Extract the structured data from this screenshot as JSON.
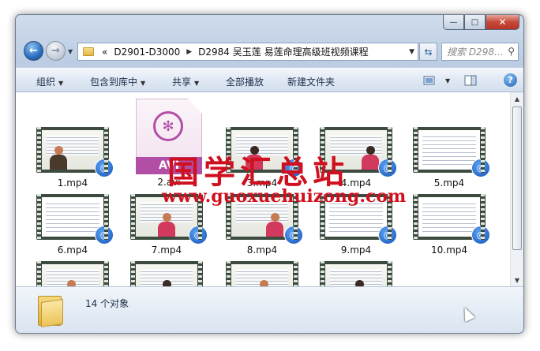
{
  "window": {
    "caption_buttons": {
      "minimize": "—",
      "maximize": "□",
      "close": "✕"
    }
  },
  "nav": {
    "back_glyph": "←",
    "forward_glyph": "→",
    "recent_glyph": "▼",
    "breadcrumb": [
      {
        "label": "«",
        "kind": "overflow"
      },
      {
        "label": "D2901-D3000"
      },
      {
        "label": "D2984 吴玉莲 易莲命理高级班视频课程"
      }
    ],
    "breadcrumb_separator": "▶",
    "address_dropdown": "▼",
    "refresh_glyph": "⇆",
    "search_placeholder": "搜索 D298...",
    "search_icon_glyph": "⚲"
  },
  "toolbar": {
    "organize": "组织",
    "include_in_library": "包含到库中",
    "share": "共享",
    "play_all": "全部播放",
    "new_folder": "新建文件夹",
    "dropdown_arrow": "▼",
    "help": "?"
  },
  "files": [
    {
      "name": "1.mp4",
      "kind": "video",
      "frame": "teacher"
    },
    {
      "name": "2.avi",
      "kind": "avi",
      "type_label": "AVI"
    },
    {
      "name": "3.mp4",
      "kind": "video",
      "frame": "teacher"
    },
    {
      "name": "4.mp4",
      "kind": "video",
      "frame": "teacher"
    },
    {
      "name": "5.mp4",
      "kind": "video",
      "frame": "doc"
    },
    {
      "name": "6.mp4",
      "kind": "video",
      "frame": "doc"
    },
    {
      "name": "7.mp4",
      "kind": "video",
      "frame": "teacher"
    },
    {
      "name": "8.mp4",
      "kind": "video",
      "frame": "teacher"
    },
    {
      "name": "9.mp4",
      "kind": "video",
      "frame": "doc"
    },
    {
      "name": "10.mp4",
      "kind": "video",
      "frame": "doc"
    },
    {
      "name": "",
      "kind": "video",
      "frame": "teacher"
    },
    {
      "name": "",
      "kind": "video",
      "frame": "teacher"
    },
    {
      "name": "",
      "kind": "video",
      "frame": "teacher"
    },
    {
      "name": "",
      "kind": "video",
      "frame": "teacher"
    }
  ],
  "scrollbar": {
    "up": "▲",
    "down": "▼"
  },
  "status": {
    "count_text": "14 个对象"
  },
  "watermark": {
    "title": "国学汇总站",
    "url": "www.guoxuehuizong.com"
  },
  "colors": {
    "accent": "#1d5fb4",
    "avi": "#b24ea6",
    "watermark": "#d0101e"
  }
}
